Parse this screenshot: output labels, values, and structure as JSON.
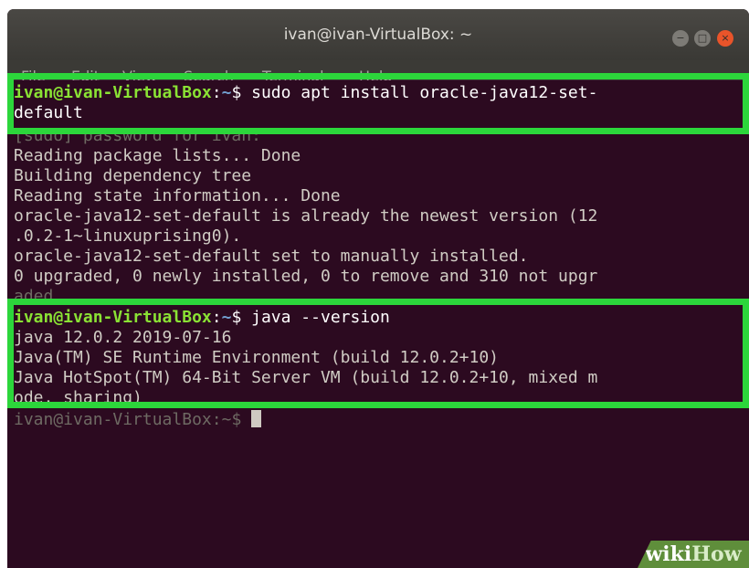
{
  "window": {
    "title": "ivan@ivan-VirtualBox: ~",
    "controls": [
      "minimize-icon",
      "maximize-icon",
      "close-icon"
    ]
  },
  "menu": [
    "File",
    "Edit",
    "View",
    "Search",
    "Terminal",
    "Help"
  ],
  "terminal": {
    "lines": [
      {
        "prompt": "ivan@ivan-VirtualBox",
        "sep": ":",
        "path": "~",
        "sym": "$",
        "cmd": " sudo apt install oracle-java12-set-"
      },
      {
        "text": "default"
      },
      {
        "text": "[sudo] password for ivan:"
      },
      {
        "text": "Reading package lists... Done"
      },
      {
        "text": "Building dependency tree"
      },
      {
        "text": "Reading state information... Done"
      },
      {
        "text": "oracle-java12-set-default is already the newest version (12"
      },
      {
        "text": ".0.2-1~linuxuprising0)."
      },
      {
        "text": "oracle-java12-set-default set to manually installed."
      },
      {
        "text": "0 upgraded, 0 newly installed, 0 to remove and 310 not upgr"
      },
      {
        "text": "aded."
      },
      {
        "prompt": "ivan@ivan-VirtualBox",
        "sep": ":",
        "path": "~",
        "sym": "$",
        "cmd": " java --version"
      },
      {
        "text": "java 12.0.2 2019-07-16"
      },
      {
        "text": "Java(TM) SE Runtime Environment (build 12.0.2+10)"
      },
      {
        "text": "Java HotSpot(TM) 64-Bit Server VM (build 12.0.2+10, mixed m"
      },
      {
        "text": "ode, sharing)"
      },
      {
        "prompt": "ivan@ivan-VirtualBox",
        "sep": ":",
        "path": "~",
        "sym": "$",
        "cmd": " "
      }
    ]
  },
  "colors": {
    "terminal_bg": "#2c0a20",
    "prompt": "#8ae234",
    "highlight_border": "#2cd63b",
    "close_button": "#e9542a"
  },
  "watermark": {
    "wiki": "wiki",
    "how": "How"
  }
}
